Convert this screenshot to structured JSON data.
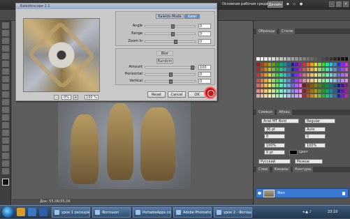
{
  "app": {
    "workspace_label": "Основная рабочая среда",
    "design_label": "Дизайн"
  },
  "dialog": {
    "title": "Kaleidoscope 2.1",
    "mode_label": "Kaleido Mode",
    "mode_value": "Kalei",
    "sliders_top": [
      {
        "label": "Angle",
        "value": "0",
        "level": 0.55
      },
      {
        "label": "Range",
        "value": "0",
        "level": 0.55
      },
      {
        "label": "Zoom In",
        "value": "0",
        "level": 0.6
      }
    ],
    "section_label": "Blur",
    "random_label": "Random",
    "sliders_bottom": [
      {
        "label": "Amount",
        "value": "100",
        "level": 0.95
      },
      {
        "label": "Horizontal",
        "value": "0",
        "level": 0.5
      },
      {
        "label": "Vertical",
        "value": "0",
        "level": 0.5
      }
    ],
    "zoom_value": "0%",
    "zoom_pct": "100 %",
    "buttons": {
      "reset": "Reset",
      "cancel": "Cancel",
      "ok": "OK"
    }
  },
  "doc_status": "Док: 55,0K/55,0K",
  "right_panel": {
    "swatches_tabs": [
      "Образцы",
      "Стили"
    ],
    "character_tabs": [
      "Символ",
      "Абзац"
    ],
    "font_name": "Arial MT Bold",
    "font_style": "Regular",
    "size": "36 pt",
    "leading": "Auto",
    "kerning": "0",
    "tracking": "0",
    "vscale": "100%",
    "hscale": "100%",
    "baseline": "0 pt",
    "color_label": "Цвет",
    "language": "Русский",
    "aa": "Резкое",
    "layers_tabs": [
      "Слои",
      "Каналы",
      "Контуры"
    ],
    "layer_name": "Фон"
  },
  "taskbar": {
    "tasks": [
      "урок 1 pscouple.jr...",
      "Фотошоп",
      "PortableApps.com",
      "Adobe Photoshop...",
      "урок 2 - Фотошоп..."
    ],
    "clock": "23:10"
  },
  "colors": {
    "accent": "#3b7ad3",
    "logo": "#c01a1a"
  }
}
